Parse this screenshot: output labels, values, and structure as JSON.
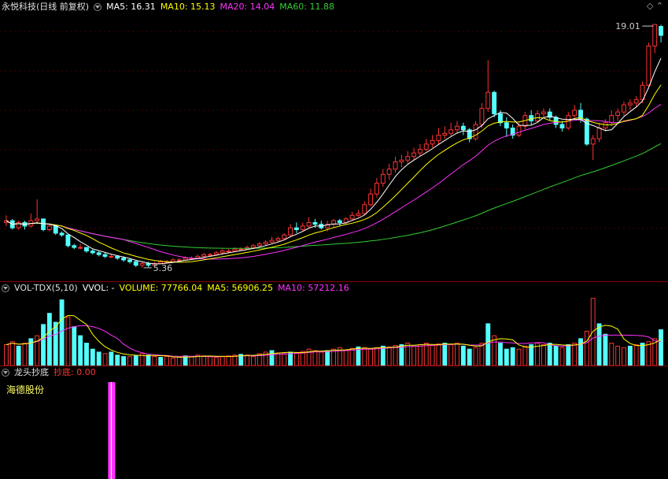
{
  "main_panel": {
    "title": "永悦科技(日线 前复权)",
    "ma_labels": [
      {
        "text": "MA5: 16.31",
        "color": "#ffffff"
      },
      {
        "text": "MA10: 15.13",
        "color": "#ffff00"
      },
      {
        "text": "MA20: 14.04",
        "color": "#ff33ff"
      },
      {
        "text": "MA60: 11.88",
        "color": "#33cc33"
      }
    ],
    "high_label": "19.01",
    "low_label": "5.36",
    "corner_icons": [
      "diamond-icon",
      "chevron-up-icon"
    ]
  },
  "volume_panel": {
    "title": "VOL-TDX(5,10)",
    "labels": [
      {
        "text": "VVOL: -",
        "color": "#ffffff"
      },
      {
        "text": "VOLUME: 77766.04",
        "color": "#ffff00"
      },
      {
        "text": "MA5: 56906.25",
        "color": "#ffff00"
      },
      {
        "text": "MA10: 57212.16",
        "color": "#ff33ff"
      }
    ]
  },
  "indicator_panel": {
    "title": "龙头抄底",
    "signal_label": "抄底: 0.00",
    "stock_name": "海德股份"
  },
  "colors": {
    "up": "#ff3333",
    "down": "#54ffff",
    "ma5": "#ffffff",
    "ma10": "#ffff00",
    "ma20": "#ff33ff",
    "ma60": "#33cc33",
    "signal": "#ff33ff"
  },
  "chart_data": {
    "type": "candlestick",
    "candles": [
      [
        7.9,
        8.0,
        8.3,
        7.7
      ],
      [
        8.0,
        7.6,
        8.1,
        7.5
      ],
      [
        7.6,
        7.9,
        8.0,
        7.5
      ],
      [
        7.9,
        7.7,
        8.0,
        7.5
      ],
      [
        7.7,
        8.0,
        8.4,
        7.6
      ],
      [
        8.0,
        8.1,
        9.2,
        7.9
      ],
      [
        8.1,
        7.5,
        8.1,
        7.4
      ],
      [
        7.5,
        7.7,
        7.8,
        7.4
      ],
      [
        7.7,
        7.3,
        7.7,
        7.2
      ],
      [
        7.3,
        7.2,
        7.4,
        7.1
      ],
      [
        7.2,
        6.6,
        7.2,
        6.5
      ],
      [
        6.6,
        6.5,
        6.7,
        6.4
      ],
      [
        6.5,
        6.5,
        6.7,
        6.4
      ],
      [
        6.5,
        6.3,
        6.5,
        6.2
      ],
      [
        6.3,
        6.2,
        6.4,
        6.1
      ],
      [
        6.2,
        6.1,
        6.3,
        6.0
      ],
      [
        6.1,
        6.0,
        6.2,
        5.9
      ],
      [
        6.0,
        6.0,
        6.1,
        5.9
      ],
      [
        6.0,
        5.9,
        6.0,
        5.8
      ],
      [
        5.9,
        5.8,
        6.0,
        5.7
      ],
      [
        5.8,
        5.7,
        5.9,
        5.6
      ],
      [
        5.7,
        5.5,
        5.8,
        5.4
      ],
      [
        5.5,
        5.6,
        5.7,
        5.36
      ],
      [
        5.6,
        5.5,
        5.7,
        5.4
      ],
      [
        5.5,
        5.6,
        5.7,
        5.5
      ],
      [
        5.6,
        5.7,
        5.8,
        5.6
      ],
      [
        5.7,
        5.7,
        5.8,
        5.6
      ],
      [
        5.7,
        5.8,
        5.9,
        5.7
      ],
      [
        5.8,
        5.8,
        5.9,
        5.7
      ],
      [
        5.8,
        5.9,
        6.0,
        5.8
      ],
      [
        5.9,
        5.9,
        6.0,
        5.8
      ],
      [
        5.9,
        6.0,
        6.1,
        5.9
      ],
      [
        6.0,
        6.1,
        6.2,
        5.9
      ],
      [
        6.1,
        6.1,
        6.2,
        6.0
      ],
      [
        6.1,
        6.2,
        6.3,
        6.1
      ],
      [
        6.2,
        6.3,
        6.4,
        6.1
      ],
      [
        6.3,
        6.3,
        6.4,
        6.2
      ],
      [
        6.3,
        6.4,
        6.5,
        6.3
      ],
      [
        6.4,
        6.4,
        6.5,
        6.3
      ],
      [
        6.4,
        6.5,
        6.6,
        6.4
      ],
      [
        6.5,
        6.6,
        6.7,
        6.4
      ],
      [
        6.6,
        6.7,
        6.8,
        6.5
      ],
      [
        6.7,
        6.8,
        6.9,
        6.6
      ],
      [
        6.8,
        6.9,
        7.1,
        6.7
      ],
      [
        6.9,
        7.0,
        7.1,
        6.8
      ],
      [
        7.0,
        7.2,
        7.3,
        6.9
      ],
      [
        7.2,
        7.6,
        7.8,
        7.1
      ],
      [
        7.6,
        7.5,
        7.9,
        7.3
      ],
      [
        7.5,
        7.7,
        7.9,
        7.4
      ],
      [
        7.7,
        7.9,
        8.2,
        7.6
      ],
      [
        7.9,
        7.8,
        8.1,
        7.6
      ],
      [
        7.8,
        7.6,
        8.0,
        7.5
      ],
      [
        7.6,
        7.8,
        8.0,
        7.4
      ],
      [
        7.8,
        8.0,
        8.1,
        7.6
      ],
      [
        8.0,
        7.9,
        8.1,
        7.7
      ],
      [
        7.9,
        8.1,
        8.2,
        7.8
      ],
      [
        8.1,
        8.3,
        8.5,
        8.0
      ],
      [
        8.3,
        8.4,
        8.6,
        8.2
      ],
      [
        8.4,
        8.9,
        9.1,
        8.3
      ],
      [
        8.9,
        9.5,
        9.8,
        8.8
      ],
      [
        9.5,
        10.1,
        10.4,
        9.3
      ],
      [
        10.1,
        10.6,
        10.9,
        9.9
      ],
      [
        10.6,
        10.9,
        11.2,
        10.3
      ],
      [
        10.9,
        11.3,
        11.6,
        10.7
      ],
      [
        11.3,
        11.4,
        11.7,
        11.0
      ],
      [
        11.4,
        11.6,
        11.9,
        11.2
      ],
      [
        11.6,
        11.8,
        12.1,
        11.4
      ],
      [
        11.8,
        12.0,
        12.3,
        11.6
      ],
      [
        12.0,
        12.3,
        12.6,
        11.9
      ],
      [
        12.3,
        12.5,
        12.8,
        12.1
      ],
      [
        12.5,
        12.8,
        13.2,
        12.3
      ],
      [
        12.8,
        12.9,
        13.3,
        12.6
      ],
      [
        12.9,
        13.1,
        13.5,
        12.7
      ],
      [
        13.1,
        13.3,
        13.6,
        12.9
      ],
      [
        13.3,
        13.1,
        13.5,
        12.8
      ],
      [
        13.1,
        12.6,
        13.2,
        12.4
      ],
      [
        12.6,
        13.4,
        13.6,
        12.5
      ],
      [
        13.4,
        14.3,
        14.6,
        13.2
      ],
      [
        14.3,
        15.2,
        17.0,
        14.1
      ],
      [
        15.2,
        14.0,
        15.3,
        13.8
      ],
      [
        14.0,
        13.5,
        14.2,
        13.3
      ],
      [
        13.5,
        13.2,
        13.8,
        12.7
      ],
      [
        13.2,
        12.8,
        13.4,
        12.6
      ],
      [
        12.8,
        13.3,
        13.5,
        12.7
      ],
      [
        13.3,
        13.9,
        14.1,
        13.1
      ],
      [
        13.9,
        13.6,
        14.2,
        13.4
      ],
      [
        13.6,
        14.0,
        14.2,
        13.5
      ],
      [
        14.0,
        14.1,
        14.3,
        13.8
      ],
      [
        14.1,
        13.8,
        14.3,
        13.6
      ],
      [
        13.8,
        13.4,
        13.9,
        13.2
      ],
      [
        13.4,
        13.2,
        13.6,
        13.0
      ],
      [
        13.2,
        13.9,
        14.1,
        13.1
      ],
      [
        13.9,
        14.2,
        14.5,
        13.8
      ],
      [
        14.2,
        13.7,
        14.6,
        13.5
      ],
      [
        13.7,
        12.3,
        13.8,
        12.2
      ],
      [
        12.3,
        12.6,
        12.8,
        11.4
      ],
      [
        12.6,
        13.2,
        13.5,
        12.4
      ],
      [
        13.2,
        13.5,
        13.7,
        13.0
      ],
      [
        13.5,
        13.9,
        14.2,
        13.3
      ],
      [
        13.9,
        14.1,
        14.3,
        13.6
      ],
      [
        14.1,
        14.5,
        14.7,
        13.9
      ],
      [
        14.5,
        14.6,
        14.8,
        14.2
      ],
      [
        14.6,
        14.8,
        15.0,
        14.4
      ],
      [
        14.8,
        15.6,
        15.8,
        14.6
      ],
      [
        15.6,
        17.8,
        18.0,
        15.5
      ],
      [
        17.8,
        19.01,
        19.01,
        17.4
      ],
      [
        18.9,
        18.4,
        19.0,
        18.0
      ]
    ],
    "volumes": [
      [
        28,
        0
      ],
      [
        32,
        0
      ],
      [
        26,
        1
      ],
      [
        30,
        0
      ],
      [
        36,
        1
      ],
      [
        40,
        0
      ],
      [
        55,
        1
      ],
      [
        70,
        1
      ],
      [
        58,
        1
      ],
      [
        88,
        1
      ],
      [
        65,
        0
      ],
      [
        52,
        1
      ],
      [
        40,
        1
      ],
      [
        30,
        1
      ],
      [
        22,
        1
      ],
      [
        18,
        1
      ],
      [
        16,
        0
      ],
      [
        18,
        1
      ],
      [
        14,
        1
      ],
      [
        12,
        1
      ],
      [
        12,
        0
      ],
      [
        13,
        1
      ],
      [
        16,
        0
      ],
      [
        14,
        1
      ],
      [
        12,
        0
      ],
      [
        11,
        1
      ],
      [
        12,
        0
      ],
      [
        10,
        0
      ],
      [
        11,
        0
      ],
      [
        13,
        1
      ],
      [
        12,
        0
      ],
      [
        14,
        0
      ],
      [
        13,
        0
      ],
      [
        12,
        0
      ],
      [
        11,
        0
      ],
      [
        12,
        0
      ],
      [
        13,
        0
      ],
      [
        14,
        0
      ],
      [
        15,
        1
      ],
      [
        14,
        0
      ],
      [
        12,
        0
      ],
      [
        16,
        0
      ],
      [
        18,
        0
      ],
      [
        20,
        1
      ],
      [
        17,
        0
      ],
      [
        16,
        0
      ],
      [
        18,
        1
      ],
      [
        17,
        0
      ],
      [
        19,
        0
      ],
      [
        22,
        0
      ],
      [
        20,
        0
      ],
      [
        18,
        0
      ],
      [
        20,
        1
      ],
      [
        22,
        0
      ],
      [
        24,
        0
      ],
      [
        21,
        0
      ],
      [
        23,
        0
      ],
      [
        25,
        1
      ],
      [
        24,
        0
      ],
      [
        22,
        0
      ],
      [
        24,
        0
      ],
      [
        26,
        1
      ],
      [
        25,
        0
      ],
      [
        27,
        0
      ],
      [
        28,
        1
      ],
      [
        30,
        0
      ],
      [
        26,
        0
      ],
      [
        28,
        0
      ],
      [
        30,
        0
      ],
      [
        27,
        0
      ],
      [
        29,
        0
      ],
      [
        30,
        1
      ],
      [
        28,
        0
      ],
      [
        30,
        0
      ],
      [
        26,
        1
      ],
      [
        22,
        1
      ],
      [
        24,
        0
      ],
      [
        30,
        0
      ],
      [
        56,
        1
      ],
      [
        40,
        0
      ],
      [
        30,
        1
      ],
      [
        22,
        1
      ],
      [
        24,
        1
      ],
      [
        22,
        0
      ],
      [
        26,
        0
      ],
      [
        28,
        1
      ],
      [
        30,
        0
      ],
      [
        28,
        0
      ],
      [
        30,
        1
      ],
      [
        26,
        1
      ],
      [
        24,
        0
      ],
      [
        28,
        1
      ],
      [
        30,
        0
      ],
      [
        36,
        1
      ],
      [
        46,
        0
      ],
      [
        90,
        0
      ],
      [
        56,
        1
      ],
      [
        42,
        1
      ],
      [
        30,
        0
      ],
      [
        26,
        0
      ],
      [
        24,
        0
      ],
      [
        26,
        1
      ],
      [
        28,
        0
      ],
      [
        30,
        1
      ],
      [
        32,
        0
      ],
      [
        36,
        0
      ],
      [
        48,
        1
      ]
    ],
    "signal_index": 17,
    "price_range": [
      5.0,
      19.5
    ],
    "high": 19.01,
    "low": 5.36
  }
}
